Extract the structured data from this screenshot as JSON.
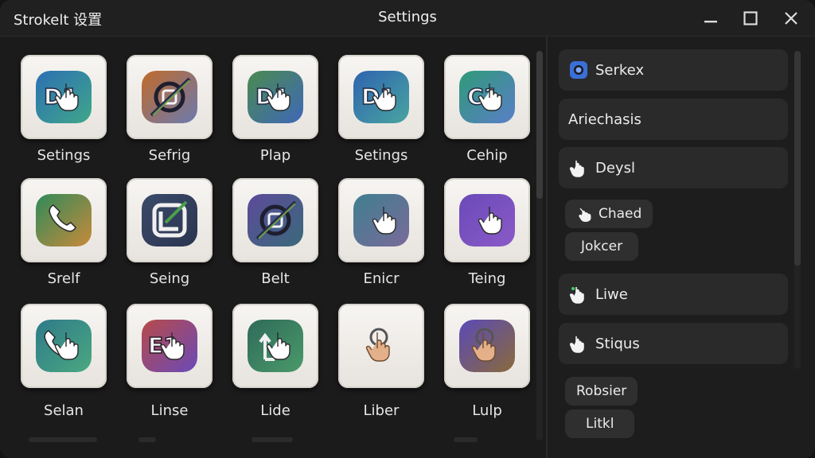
{
  "window": {
    "app_title": "Strokelt 设置",
    "title": "Settings"
  },
  "tiles": [
    {
      "label": "Setings",
      "icon": "d1-touch-icon"
    },
    {
      "label": "Sefrig",
      "icon": "slash-target-icon"
    },
    {
      "label": "Plap",
      "icon": "d1-touch-icon"
    },
    {
      "label": "Setings",
      "icon": "d1-touch-icon"
    },
    {
      "label": "Cehip",
      "icon": "c1-touch-icon"
    },
    {
      "label": "Srelf",
      "icon": "phone-icon"
    },
    {
      "label": "Seing",
      "icon": "corner-check-icon"
    },
    {
      "label": "Belt",
      "icon": "slash-target-icon"
    },
    {
      "label": "Enicr",
      "icon": "pointer-hand-icon"
    },
    {
      "label": "Teing",
      "icon": "pointer-hand-icon"
    },
    {
      "label": "Selan",
      "icon": "phone-touch-icon"
    },
    {
      "label": "Linse",
      "icon": "e1-touch-icon"
    },
    {
      "label": "Lide",
      "icon": "l-arrow-touch-icon"
    },
    {
      "label": "Liber",
      "icon": "tap-hand-icon"
    },
    {
      "label": "Lulp",
      "icon": "pointer-hand-icon"
    }
  ],
  "right_panel": {
    "rows": [
      {
        "label": "Serkex",
        "icon": "toggle-dot-icon"
      },
      {
        "label": "Ariechasis",
        "icon": ""
      },
      {
        "label": "Deysl",
        "icon": "hand-pointer-icon"
      }
    ],
    "chips_a": [
      {
        "label": "Chaed",
        "icon": "hand-pointer-icon"
      },
      {
        "label": "Jokcer",
        "icon": ""
      }
    ],
    "rows_b": [
      {
        "label": "Liwe",
        "icon": "hand-pointer-icon"
      },
      {
        "label": "Stiqus",
        "icon": "hand-pointer-icon"
      }
    ],
    "chips_b": [
      {
        "label": "Robsier"
      },
      {
        "label": "Litkl"
      }
    ]
  }
}
